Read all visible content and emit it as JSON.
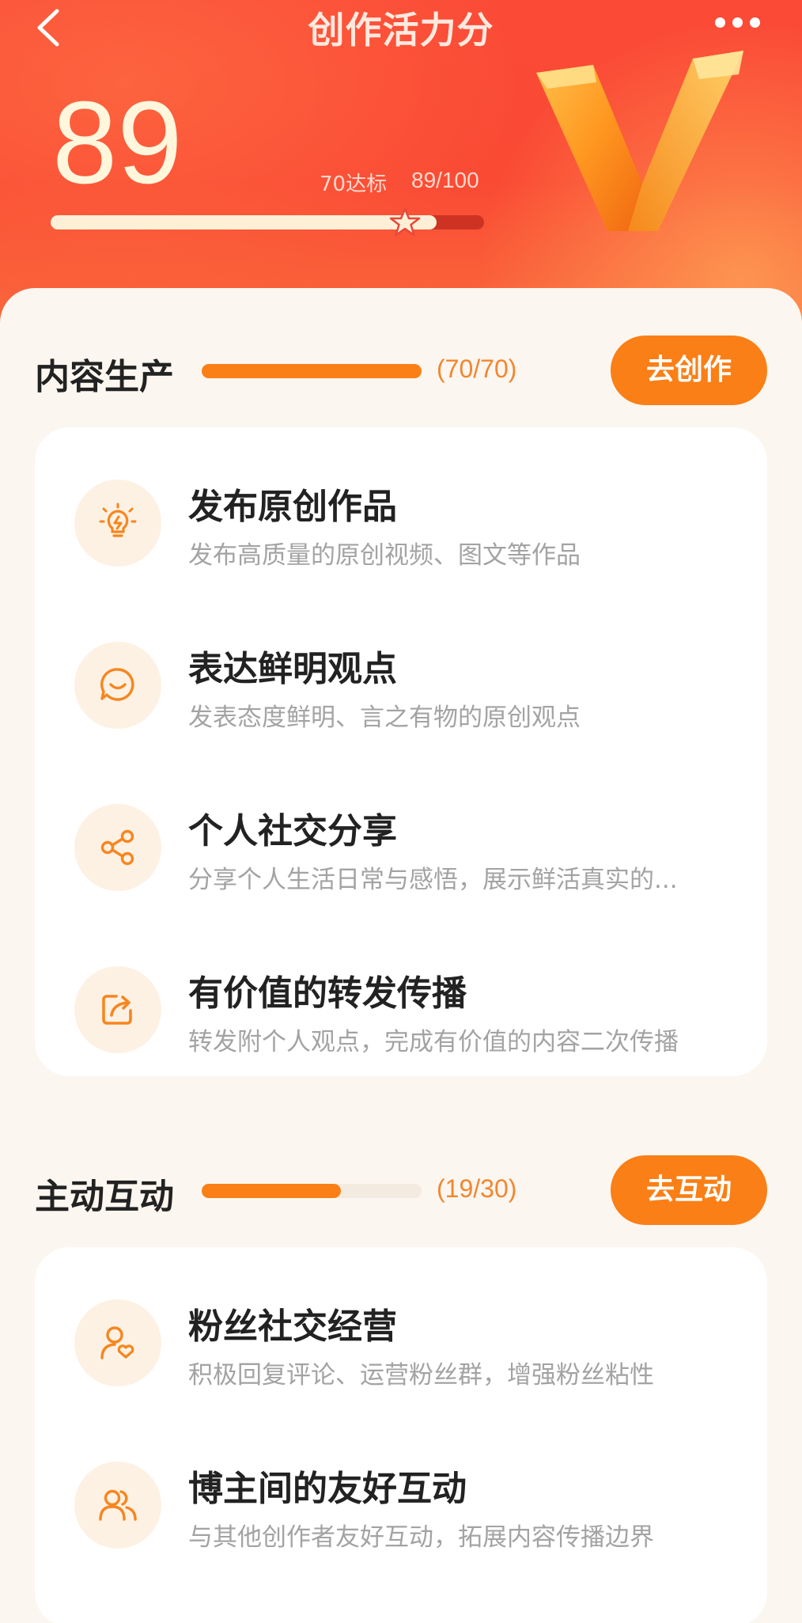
{
  "header": {
    "title": "创作活力分",
    "score": "89",
    "standard_label": "70达标",
    "ratio_label": "89/100",
    "progress": 0.89,
    "standard_threshold": 0.7
  },
  "colors": {
    "header_red": "#fb4b37",
    "accent_orange": "#fa7f16",
    "count_orange": "#f2862f",
    "page_bg": "#fbf6ef",
    "icon_bg": "#fdf1e4"
  },
  "sections": [
    {
      "title": "内容生产",
      "count_text": "(70/70)",
      "progress": 1.0,
      "button_label": "去创作",
      "tasks": [
        {
          "icon": "lightbulb-icon",
          "title": "发布原创作品",
          "desc": "发布高质量的原创视频、图文等作品"
        },
        {
          "icon": "chat-smile-icon",
          "title": "表达鲜明观点",
          "desc": "发表态度鲜明、言之有物的原创观点"
        },
        {
          "icon": "share-icon",
          "title": "个人社交分享",
          "desc": "分享个人生活日常与感悟，展示鲜活真实的..."
        },
        {
          "icon": "forward-icon",
          "title": "有价值的转发传播",
          "desc": "转发附个人观点，完成有价值的内容二次传播"
        }
      ]
    },
    {
      "title": "主动互动",
      "count_text": "(19/30)",
      "progress": 0.633,
      "button_label": "去互动",
      "tasks": [
        {
          "icon": "user-heart-icon",
          "title": "粉丝社交经营",
          "desc": "积极回复评论、运营粉丝群，增强粉丝粘性"
        },
        {
          "icon": "users-icon",
          "title": "博主间的友好互动",
          "desc": "与其他创作者友好互动，拓展内容传播边界"
        }
      ]
    }
  ]
}
